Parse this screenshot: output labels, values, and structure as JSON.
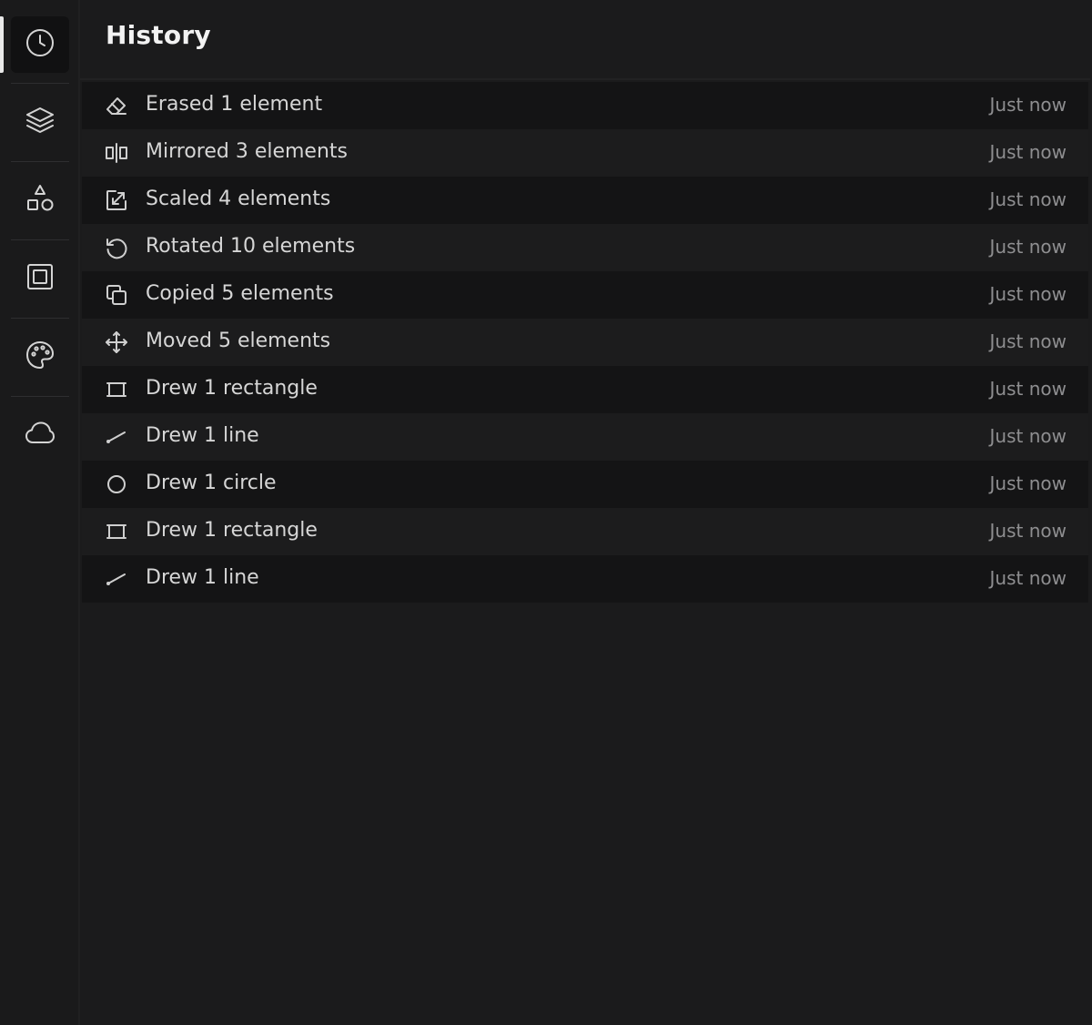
{
  "panel": {
    "title": "History"
  },
  "sidebar": {
    "items": [
      {
        "name": "history",
        "icon": "clock-icon",
        "active": true
      },
      {
        "name": "layers",
        "icon": "layers-icon",
        "active": false
      },
      {
        "name": "shapes",
        "icon": "shapes-icon",
        "active": false
      },
      {
        "name": "frame",
        "icon": "frame-icon",
        "active": false
      },
      {
        "name": "palette",
        "icon": "palette-icon",
        "active": false
      },
      {
        "name": "cloud",
        "icon": "cloud-icon",
        "active": false
      }
    ]
  },
  "history": [
    {
      "label": "Erased 1 element",
      "time": "Just now",
      "icon": "eraser-icon"
    },
    {
      "label": "Mirrored 3 elements",
      "time": "Just now",
      "icon": "mirror-icon"
    },
    {
      "label": "Scaled 4 elements",
      "time": "Just now",
      "icon": "scale-icon"
    },
    {
      "label": "Rotated 10 elements",
      "time": "Just now",
      "icon": "rotate-icon"
    },
    {
      "label": "Copied 5 elements",
      "time": "Just now",
      "icon": "copy-icon"
    },
    {
      "label": "Moved 5 elements",
      "time": "Just now",
      "icon": "move-icon"
    },
    {
      "label": "Drew 1 rectangle",
      "time": "Just now",
      "icon": "rectangle-icon"
    },
    {
      "label": "Drew 1 line",
      "time": "Just now",
      "icon": "line-icon"
    },
    {
      "label": "Drew 1 circle",
      "time": "Just now",
      "icon": "circle-icon"
    },
    {
      "label": "Drew 1 rectangle",
      "time": "Just now",
      "icon": "rectangle-icon"
    },
    {
      "label": "Drew 1 line",
      "time": "Just now",
      "icon": "line-icon"
    }
  ],
  "colors": {
    "background": "#1b1b1c",
    "row_dark": "#141415",
    "row_light": "#1c1c1d",
    "text": "#d6d6d6",
    "muted": "#8e8e90"
  }
}
